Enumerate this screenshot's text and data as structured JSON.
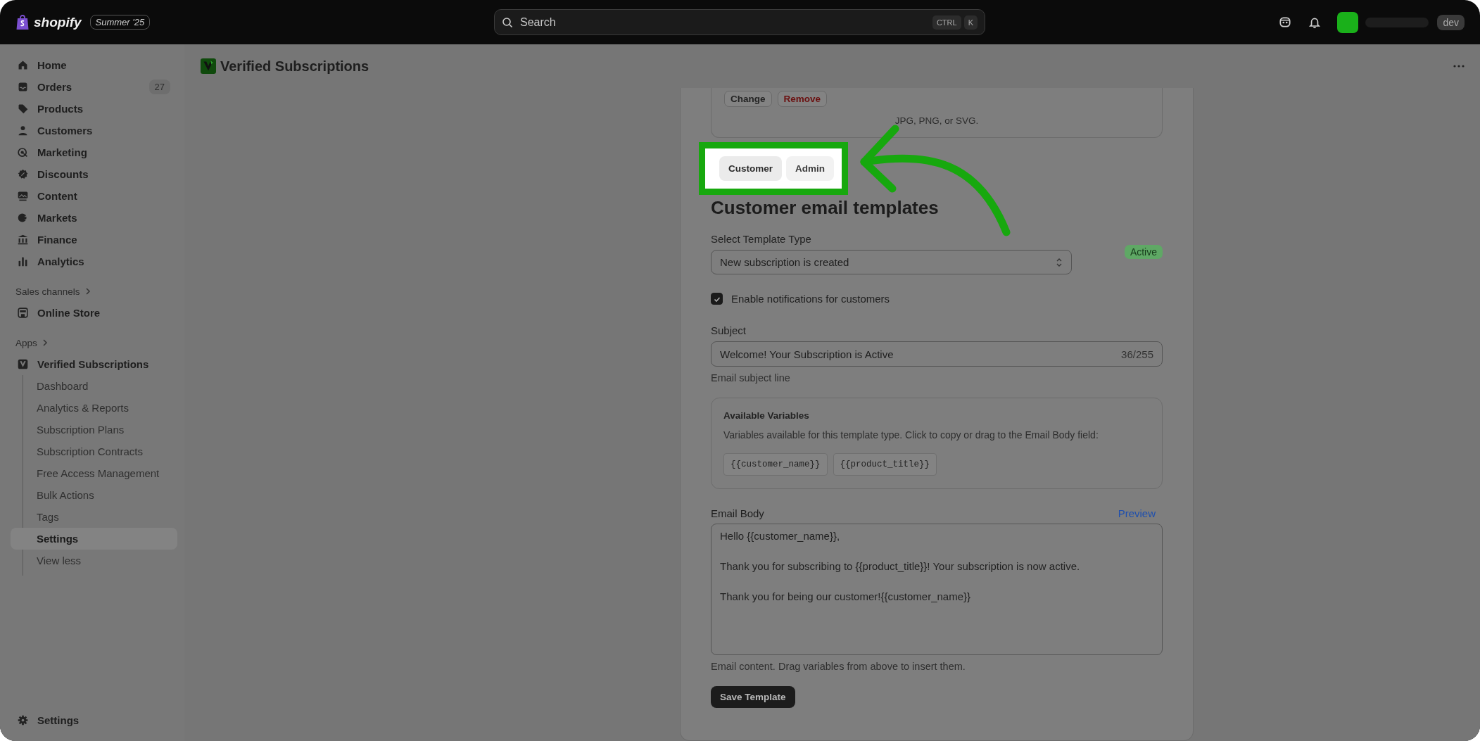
{
  "topbar": {
    "brand": "shopify",
    "edition": "Summer '25",
    "search": {
      "placeholder": "Search",
      "keys": [
        "CTRL",
        "K"
      ]
    },
    "store_badge": "dev"
  },
  "sidebar": {
    "items": [
      {
        "label": "Home",
        "kind": "home"
      },
      {
        "label": "Orders",
        "kind": "orders",
        "badge": "27"
      },
      {
        "label": "Products",
        "kind": "tag"
      },
      {
        "label": "Customers",
        "kind": "person"
      },
      {
        "label": "Marketing",
        "kind": "target"
      },
      {
        "label": "Discounts",
        "kind": "discount"
      },
      {
        "label": "Content",
        "kind": "image"
      },
      {
        "label": "Markets",
        "kind": "globe"
      },
      {
        "label": "Finance",
        "kind": "bank"
      },
      {
        "label": "Analytics",
        "kind": "bars"
      }
    ],
    "sections": [
      {
        "label": "Sales channels",
        "items": [
          {
            "label": "Online Store",
            "kind": "store"
          }
        ]
      },
      {
        "label": "Apps",
        "items": [
          {
            "label": "Verified Subscriptions",
            "kind": "app",
            "children": [
              {
                "label": "Dashboard",
                "selected": false
              },
              {
                "label": "Analytics & Reports",
                "selected": false
              },
              {
                "label": "Subscription Plans",
                "selected": false
              },
              {
                "label": "Subscription Contracts",
                "selected": false
              },
              {
                "label": "Free Access Management",
                "selected": false
              },
              {
                "label": "Bulk Actions",
                "selected": false
              },
              {
                "label": "Tags",
                "selected": false
              },
              {
                "label": "Settings",
                "selected": true
              },
              {
                "label": "View less",
                "selected": false
              }
            ]
          }
        ]
      }
    ],
    "footer": {
      "label": "Settings"
    }
  },
  "page": {
    "title": "Verified Subscriptions",
    "upload": {
      "buttons": [
        {
          "label": "Change",
          "kind": "default"
        },
        {
          "label": "Remove",
          "kind": "critical"
        }
      ],
      "hint": "JPG, PNG, or SVG."
    },
    "tabs": [
      {
        "label": "Customer",
        "selected": true
      },
      {
        "label": "Admin",
        "selected": false
      }
    ],
    "heading": "Customer email templates",
    "template_type": {
      "label": "Select Template Type",
      "value": "New subscription is created",
      "status": "Active"
    },
    "notifications": {
      "label": "Enable notifications for customers",
      "checked": true
    },
    "subject": {
      "label": "Subject",
      "value": "Welcome! Your Subscription is Active",
      "counter": "36/255",
      "help": "Email subject line"
    },
    "variables": {
      "title": "Available Variables",
      "description": "Variables available for this template type. Click to copy or drag to the Email Body field:",
      "items": [
        "{{customer_name}}",
        "{{product_title}}"
      ]
    },
    "email_body": {
      "label": "Email Body",
      "preview": "Preview",
      "lines": [
        "Hello {{customer_name}},",
        "Thank you for subscribing to {{product_title}}! Your subscription is now active.",
        "Thank you for being our customer!{{customer_name}}"
      ],
      "help": "Email content. Drag variables from above to insert them."
    },
    "save_button": "Save Template"
  }
}
